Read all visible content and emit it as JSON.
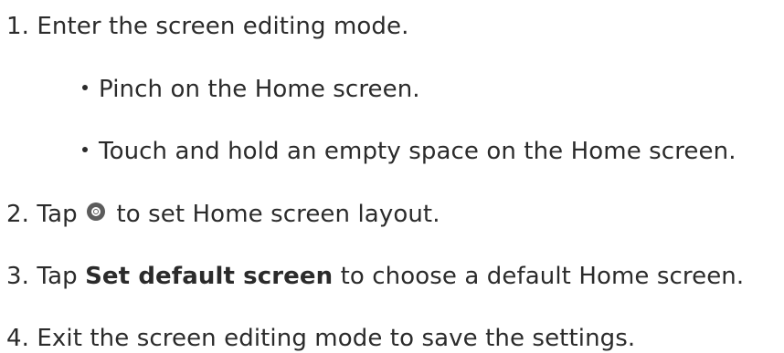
{
  "steps": [
    {
      "number": "1.",
      "text": "Enter the screen editing mode.",
      "bullets": [
        "Pinch on the Home screen.",
        "Touch and hold an empty space on the Home screen."
      ]
    },
    {
      "number": "2.",
      "prefix": "Tap",
      "icon": "settings-gear-icon",
      "suffix": "to set Home screen layout."
    },
    {
      "number": "3.",
      "prefix": "Tap",
      "bold": "Set default screen",
      "suffix": "to choose a default Home screen."
    },
    {
      "number": "4.",
      "text": "Exit the screen editing mode to save the settings."
    }
  ]
}
